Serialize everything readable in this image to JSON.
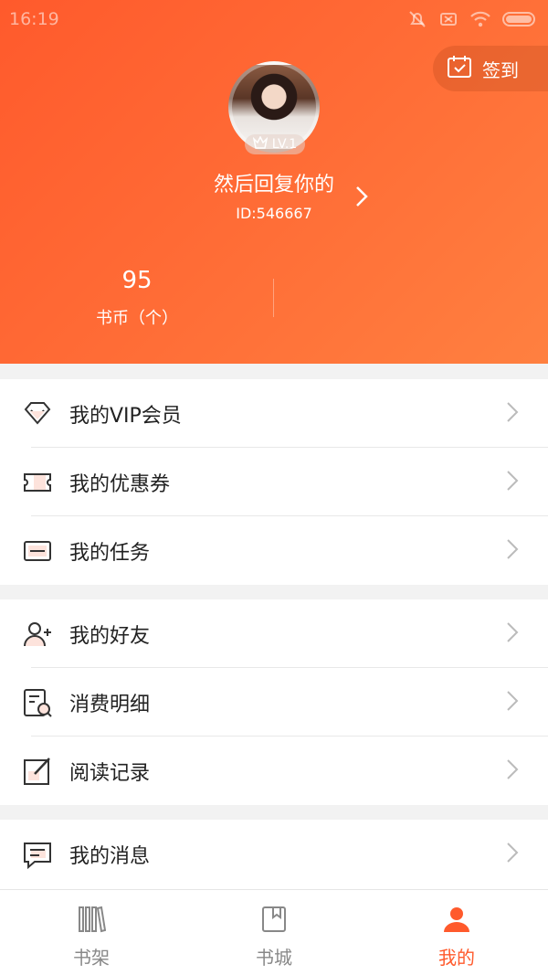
{
  "status_bar": {
    "time": "16:19"
  },
  "header": {
    "checkin_label": "签到",
    "level": "LV.1",
    "username": "然后回复你的",
    "user_id": "ID:546667",
    "coins_value": "95",
    "coins_label": "书币（个）"
  },
  "menu_groups": [
    {
      "items": [
        {
          "icon": "vip-diamond-icon",
          "label": "我的VIP会员"
        },
        {
          "icon": "coupon-icon",
          "label": "我的优惠券"
        },
        {
          "icon": "task-icon",
          "label": "我的任务"
        }
      ]
    },
    {
      "items": [
        {
          "icon": "add-friend-icon",
          "label": "我的好友"
        },
        {
          "icon": "bill-search-icon",
          "label": "消费明细"
        },
        {
          "icon": "edit-record-icon",
          "label": "阅读记录"
        }
      ]
    },
    {
      "items": [
        {
          "icon": "message-icon",
          "label": "我的消息"
        }
      ]
    }
  ],
  "tabbar": {
    "tabs": [
      {
        "label": "书架",
        "icon": "bookshelf-icon",
        "active": false
      },
      {
        "label": "书城",
        "icon": "bookstore-icon",
        "active": false
      },
      {
        "label": "我的",
        "icon": "profile-icon",
        "active": true
      }
    ]
  },
  "colors": {
    "accent": "#ff5a2c",
    "icon_fill": "#fde3dc",
    "icon_stroke": "#333333"
  }
}
